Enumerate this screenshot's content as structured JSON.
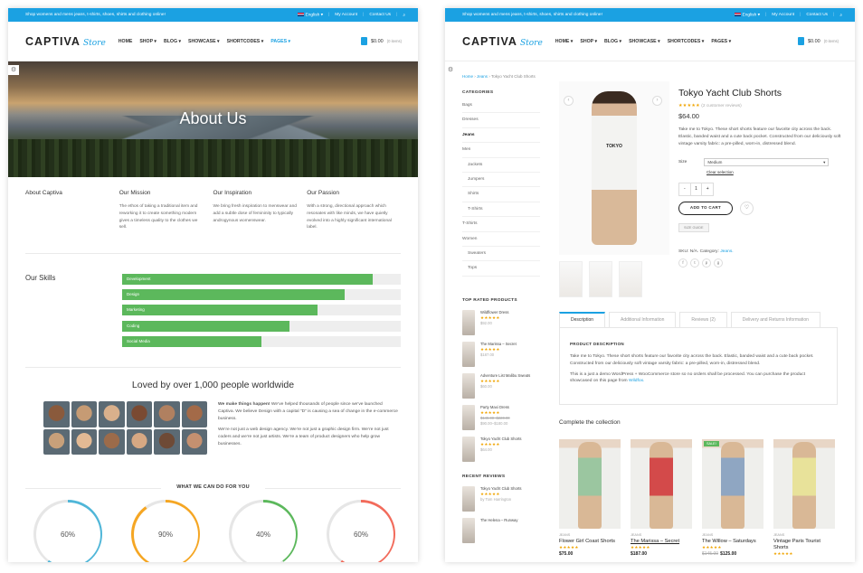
{
  "topbar": {
    "message": "Shop womens and mens jeans, t-shirts, shoes, shirts and clothing online!",
    "language": "English",
    "account": "My Account",
    "contact": "Contact Us"
  },
  "logo": {
    "main": "CAPTIVA",
    "script": "Store"
  },
  "nav": [
    "HOME",
    "SHOP",
    "BLOG",
    "SHOWCASE",
    "SHORTCODES",
    "PAGES"
  ],
  "cart": {
    "total": "$0.00",
    "items": "(0 items)"
  },
  "about": {
    "hero_title": "About Us",
    "columns": [
      {
        "title": "About Captiva",
        "text": ""
      },
      {
        "title": "Our Mission",
        "text": "The ethos of taking a traditional item and reworking it to create something modern gives a timeless quality to the clothes we sell."
      },
      {
        "title": "Our Inspiration",
        "text": "We bring fresh inspiration to menswear and add a subtle dose of femininity to typically androgynous womenswear."
      },
      {
        "title": "Our Passion",
        "text": "With a strong, directional approach which resonates with like minds, we have quietly evolved into a highly significant international label."
      }
    ],
    "skills_title": "Our Skills",
    "skills": [
      {
        "label": "Development",
        "value": 0.9
      },
      {
        "label": "Design",
        "value": 0.8
      },
      {
        "label": "Marketing",
        "value": 0.7
      },
      {
        "label": "Coding",
        "value": 0.6
      },
      {
        "label": "Social Media",
        "value": 0.5
      }
    ],
    "love_title": "Loved by over 1,000 people worldwide",
    "love_bold": "We make things happen!",
    "love_text1": " We’ve helped thousands of people since we’ve launched Captiva. We believe Design with a capital “D” is causing a sea of change in the e-commerce business.",
    "love_text2": "We’re not just a web design agency. We’re not just a graphic design firm. We’re not just coders and we’re not just artists. We’re a team of product designers who help grow businesses.",
    "what_title": "WHAT WE CAN DO FOR YOU",
    "rings": [
      {
        "label": "60%",
        "value": 0.6,
        "color": "#4fb6d8"
      },
      {
        "label": "90%",
        "value": 0.9,
        "color": "#f5a623"
      },
      {
        "label": "40%",
        "value": 0.4,
        "color": "#5cb85c"
      },
      {
        "label": "60%",
        "value": 0.6,
        "color": "#f26b5b"
      }
    ]
  },
  "shop": {
    "breadcrumb": [
      "Home",
      "Jeans",
      "Tokyo Yacht Club Shorts"
    ],
    "categories_title": "CATEGORIES",
    "categories": [
      {
        "label": "Bags",
        "level": 0
      },
      {
        "label": "Dresses",
        "level": 0
      },
      {
        "label": "Jeans",
        "level": 0,
        "current": true
      },
      {
        "label": "Men",
        "level": 0
      },
      {
        "label": "Jackets",
        "level": 1
      },
      {
        "label": "Jumpers",
        "level": 1
      },
      {
        "label": "Shirts",
        "level": 1
      },
      {
        "label": "T-Shirts",
        "level": 1
      },
      {
        "label": "T-Shirts",
        "level": 0
      },
      {
        "label": "Women",
        "level": 0
      },
      {
        "label": "Sweaters",
        "level": 1
      },
      {
        "label": "Tops",
        "level": 1
      }
    ],
    "top_rated_title": "TOP RATED PRODUCTS",
    "top_rated": [
      {
        "name": "Wildflower Dress",
        "stars": "★★★★★",
        "price": "$92.00"
      },
      {
        "name": "The Marissa – Secret",
        "stars": "★★★★★",
        "price": "$187.00"
      },
      {
        "name": "Adventure List Malibu Sweats",
        "stars": "★★★★★",
        "price": "$60.00"
      },
      {
        "name": "Party Maxi Dress",
        "stars": "★★★★★",
        "old_price": "$145.00–$220.00",
        "price": "$90.00–$180.00"
      },
      {
        "name": "Tokyo Yacht Club Shorts",
        "stars": "★★★★★",
        "price": "$64.00"
      }
    ],
    "recent_reviews_title": "RECENT REVIEWS",
    "recent_reviews": [
      {
        "name": "Tokyo Yacht Club Shorts",
        "stars": "★★★★★",
        "by": "by Tom Harrington"
      },
      {
        "name": "The Helena – Runway",
        "stars": "",
        "by": ""
      }
    ],
    "product": {
      "title": "Tokyo Yacht Club Shorts",
      "stars": "★★★★★",
      "reviews": "(2 customer reviews)",
      "price": "$64.00",
      "description": "Take me to Tokyo. These short shorts feature our favorite city across the back. Elastic, banded waist and a cute back pocket. Constructed from our deliciously soft vintage varsity fabric: a pre-pilled, worn-in, distressed blend.",
      "size_label": "Size",
      "size_value": "Medium",
      "clear": "Clear selection",
      "qty_minus": "-",
      "qty": "1",
      "qty_plus": "+",
      "add_to_cart": "ADD TO CART",
      "size_guide": "SIZE GUIDE",
      "sku": "SKU: N/A. Category:",
      "category": "Jeans.",
      "shirt_text": "TOKYO"
    },
    "tabs": [
      "Description",
      "Additional Information",
      "Reviews (2)",
      "Delivery and Returns Information"
    ],
    "tab_heading": "PRODUCT DESCRIPTION",
    "tab_p1": "Take me to Tokyo. These short shorts feature our favorite city across the back. Elastic, banded waist and a cute back pocket. Constructed from our deliciously soft vintage varsity fabric: a pre-pilled, worn-in, distressed blend.",
    "tab_p2": "This is a just a demo WordPress + WooCommerce store so no orders shall be processed. You can purchase the product showcased on this page from ",
    "tab_p2_link": "Wildfox.",
    "collection_title": "Complete the collection",
    "collection": [
      {
        "cat": "JEANS",
        "name": "Flower Girl Coast Shorts",
        "stars": "★★★★★",
        "price": "$75.00",
        "color": "#9bc6a0",
        "sale": "",
        "underline": false
      },
      {
        "cat": "JEANS",
        "name": "The Marissa – Secret",
        "stars": "★★★★★",
        "price": "$187.00",
        "color": "#d34a4a",
        "sale": "",
        "underline": true
      },
      {
        "cat": "JEANS",
        "name": "The Willow – Saturdays",
        "stars": "★★★★★",
        "old_price": "$145.00",
        "price": "$125.00",
        "color": "#8fa6c2",
        "sale": "SALE!",
        "underline": false
      },
      {
        "cat": "JEANS",
        "name": "Vintage Paris Tourist Shorts",
        "stars": "★★★★★",
        "price": "",
        "color": "#e8e29a",
        "sale": "",
        "underline": false
      }
    ]
  }
}
